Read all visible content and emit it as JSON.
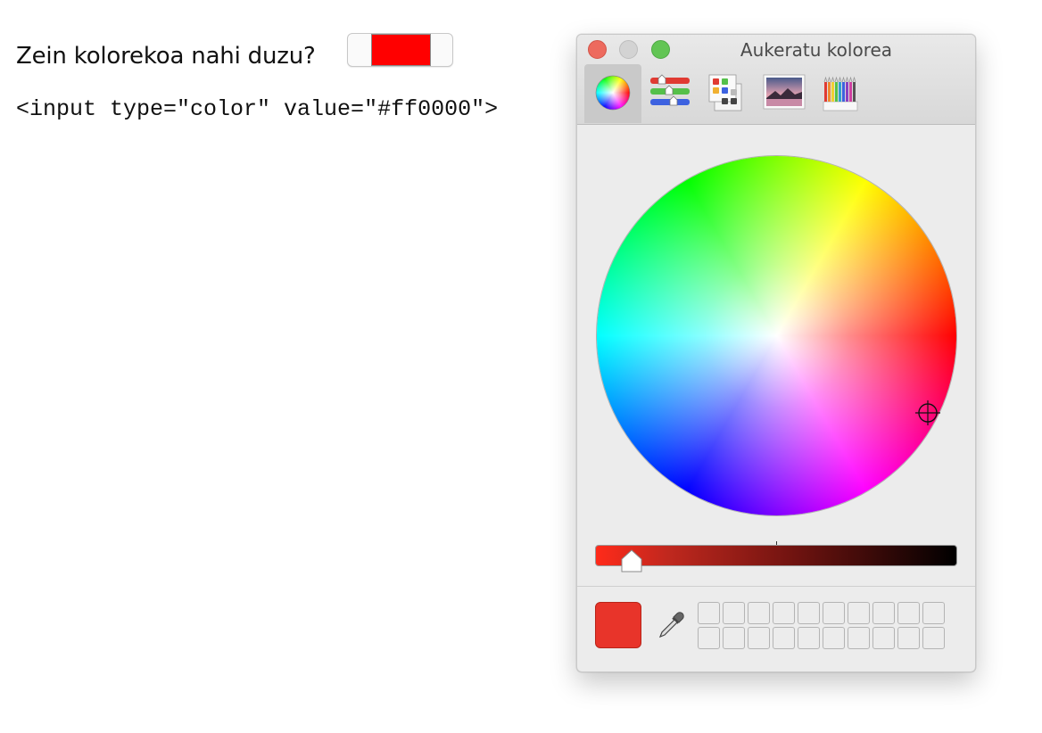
{
  "page": {
    "question": "Zein kolorekoa nahi duzu?",
    "code": "<input type=\"color\" value=\"#ff0000\">",
    "input_value_color": "#ff0000"
  },
  "color_panel": {
    "title": "Aukeratu kolorea",
    "window_controls": [
      "close-button",
      "minimize-button",
      "zoom-button"
    ],
    "modes": [
      {
        "icon": "color-wheel-icon",
        "active": true
      },
      {
        "icon": "color-sliders-icon",
        "active": false
      },
      {
        "icon": "color-palettes-icon",
        "active": false
      },
      {
        "icon": "image-palettes-icon",
        "active": false
      },
      {
        "icon": "pencils-icon",
        "active": false
      }
    ],
    "selected_color": "#e8342a",
    "brightness_level": 0.1,
    "eyedropper_icon": "eyedropper-icon",
    "swatch_slots": 20
  }
}
